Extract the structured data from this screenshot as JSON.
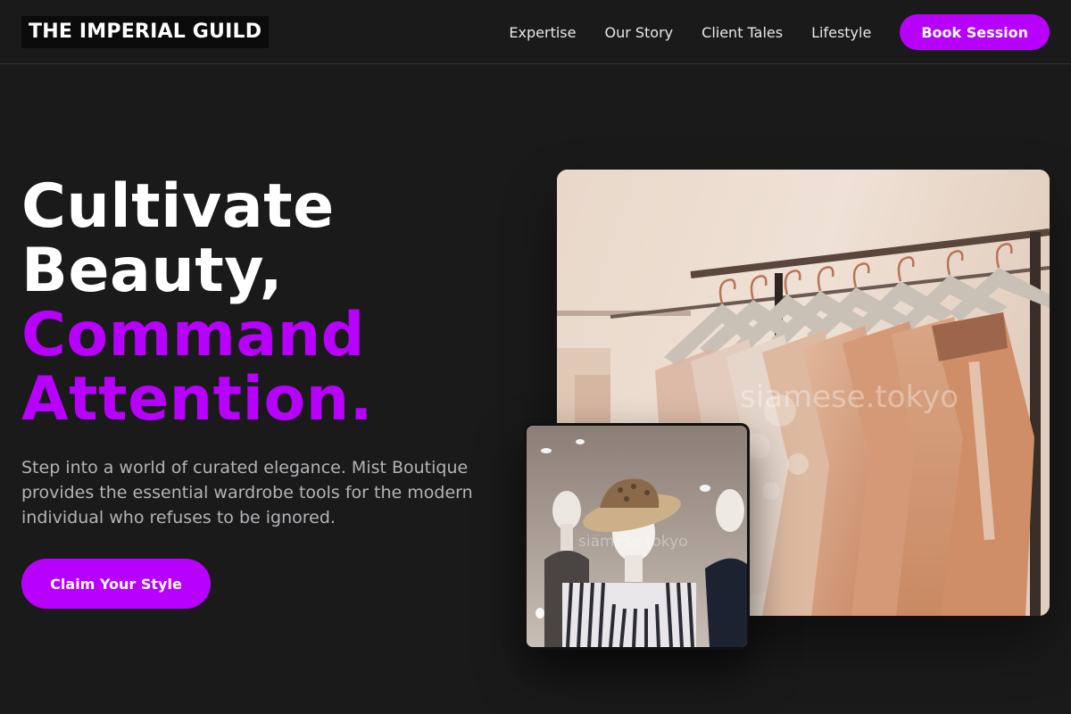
{
  "header": {
    "logo": "THE IMPERIAL GUILD",
    "nav": [
      {
        "label": "Expertise"
      },
      {
        "label": "Our Story"
      },
      {
        "label": "Client Tales"
      },
      {
        "label": "Lifestyle"
      }
    ],
    "cta_label": "Book Session"
  },
  "hero": {
    "title_line1": "Cultivate",
    "title_line2": "Beauty,",
    "title_line3": "Command",
    "title_line4": "Attention.",
    "description": "Step into a world of curated elegance. Mist Boutique provides the essential wardrobe tools for the modern individual who refuses to be ignored.",
    "cta_label": "Claim Your Style"
  },
  "images": {
    "main_watermark": "siamese.tokyo",
    "inset_watermark": "siamese.tokyo"
  },
  "colors": {
    "background": "#1a1a1b",
    "accent": "#b800ff",
    "text": "#ffffff",
    "muted_text": "#b4b4b8"
  }
}
